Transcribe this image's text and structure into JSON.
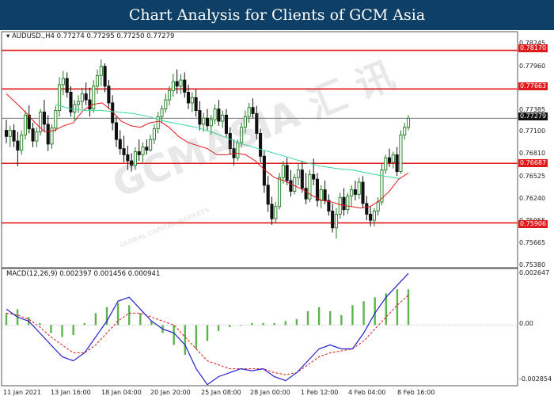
{
  "title": "Chart Analysis for Clients of GCM Asia",
  "watermark": {
    "main": "GCMASIA 汇 讯",
    "sub": "GLOBAL CAPITAL MARKETS"
  },
  "price_info": {
    "symbol": "AUDUSD.,H4",
    "open": "0.77274",
    "high": "0.77295",
    "low": "0.77250",
    "close": "0.77279"
  },
  "macd_info": {
    "name": "MACD(12,26,9)",
    "macd": "0.002397",
    "signal": "0.001456",
    "hist": "0.000941"
  },
  "price_ticks": [
    "0.78245",
    "0.77960",
    "0.77385",
    "0.77100",
    "0.76810",
    "0.76525",
    "0.76240",
    "0.75955",
    "0.75665",
    "0.75380"
  ],
  "macd_ticks": [
    "0.002647",
    "0.00",
    "-0.002854"
  ],
  "levels": [
    "0.78170",
    "0.77663",
    "0.76687",
    "0.75906"
  ],
  "current_price": "0.77279",
  "time_labels": [
    "11 Jan 2021",
    "13 Jan 16:00",
    "18 Jan 04:00",
    "20 Jan 20:00",
    "25 Jan 08:00",
    "28 Jan 00:00",
    "1 Feb 12:00",
    "4 Feb 04:00",
    "8 Feb 16:00"
  ],
  "colors": {
    "title_bg": "#0e3f66",
    "level": "#e0191b",
    "up": "#1f7a1f",
    "down": "#111111",
    "ma_fast": "#e0191b",
    "ma_slow": "#38d99a",
    "macd_line": "#2222cc",
    "signal_line": "#e0191b",
    "histogram": "#5bb54a"
  },
  "chart_data": {
    "type": "candlestick",
    "title": "",
    "symbol": "AUDUSD.,H4",
    "y_range": [
      0.7538,
      0.7829
    ],
    "support_resistance": [
      0.7817,
      0.77663,
      0.76687,
      0.75906
    ],
    "current_price": 0.77279,
    "ohlc": [
      [
        0.7712,
        0.7726,
        0.7695,
        0.7704
      ],
      [
        0.7704,
        0.7718,
        0.769,
        0.7712
      ],
      [
        0.7712,
        0.772,
        0.769,
        0.7698
      ],
      [
        0.7698,
        0.771,
        0.7665,
        0.7686
      ],
      [
        0.7686,
        0.7712,
        0.768,
        0.7706
      ],
      [
        0.7706,
        0.7738,
        0.77,
        0.7732
      ],
      [
        0.7732,
        0.7745,
        0.7708,
        0.7714
      ],
      [
        0.7714,
        0.7722,
        0.769,
        0.7698
      ],
      [
        0.7698,
        0.7716,
        0.769,
        0.771
      ],
      [
        0.771,
        0.774,
        0.7705,
        0.7736
      ],
      [
        0.7736,
        0.7752,
        0.771,
        0.772
      ],
      [
        0.772,
        0.7732,
        0.7685,
        0.7694
      ],
      [
        0.7694,
        0.772,
        0.7688,
        0.7715
      ],
      [
        0.7715,
        0.7744,
        0.771,
        0.7738
      ],
      [
        0.7738,
        0.7782,
        0.773,
        0.7772
      ],
      [
        0.7772,
        0.779,
        0.7758,
        0.778
      ],
      [
        0.778,
        0.7788,
        0.7755,
        0.7762
      ],
      [
        0.7762,
        0.777,
        0.773,
        0.7736
      ],
      [
        0.7736,
        0.7752,
        0.7725,
        0.7746
      ],
      [
        0.7746,
        0.7758,
        0.7735,
        0.775
      ],
      [
        0.775,
        0.7768,
        0.774,
        0.776
      ],
      [
        0.776,
        0.7775,
        0.7745,
        0.7752
      ],
      [
        0.7752,
        0.7768,
        0.773,
        0.774
      ],
      [
        0.774,
        0.7778,
        0.7735,
        0.777
      ],
      [
        0.777,
        0.7792,
        0.776,
        0.7784
      ],
      [
        0.7784,
        0.7805,
        0.777,
        0.7796
      ],
      [
        0.7796,
        0.78,
        0.7762,
        0.777
      ],
      [
        0.777,
        0.7778,
        0.774,
        0.7748
      ],
      [
        0.7748,
        0.7758,
        0.7712,
        0.7722
      ],
      [
        0.7722,
        0.773,
        0.769,
        0.77
      ],
      [
        0.77,
        0.7712,
        0.768,
        0.7688
      ],
      [
        0.7688,
        0.7705,
        0.767,
        0.768
      ],
      [
        0.768,
        0.7692,
        0.766,
        0.7672
      ],
      [
        0.7672,
        0.7682,
        0.7658,
        0.7666
      ],
      [
        0.7666,
        0.769,
        0.766,
        0.7684
      ],
      [
        0.7684,
        0.77,
        0.7672,
        0.768
      ],
      [
        0.768,
        0.7696,
        0.767,
        0.769
      ],
      [
        0.769,
        0.77,
        0.768,
        0.7686
      ],
      [
        0.7686,
        0.7706,
        0.7684,
        0.77
      ],
      [
        0.77,
        0.772,
        0.7694,
        0.7714
      ],
      [
        0.7714,
        0.7736,
        0.7708,
        0.773
      ],
      [
        0.773,
        0.7745,
        0.7722,
        0.774
      ],
      [
        0.774,
        0.776,
        0.7735,
        0.7752
      ],
      [
        0.7752,
        0.777,
        0.7745,
        0.7764
      ],
      [
        0.7764,
        0.7786,
        0.7756,
        0.7776
      ],
      [
        0.7776,
        0.7792,
        0.776,
        0.777
      ],
      [
        0.777,
        0.7786,
        0.776,
        0.7778
      ],
      [
        0.7778,
        0.7788,
        0.7755,
        0.7762
      ],
      [
        0.7762,
        0.7772,
        0.774,
        0.7748
      ],
      [
        0.7748,
        0.7762,
        0.7736,
        0.7755
      ],
      [
        0.7755,
        0.7766,
        0.773,
        0.7738
      ],
      [
        0.7738,
        0.775,
        0.7712,
        0.772
      ],
      [
        0.772,
        0.7735,
        0.771,
        0.7728
      ],
      [
        0.7728,
        0.774,
        0.7712,
        0.7718
      ],
      [
        0.7718,
        0.7732,
        0.7706,
        0.7726
      ],
      [
        0.7726,
        0.7746,
        0.772,
        0.774
      ],
      [
        0.774,
        0.7752,
        0.7718,
        0.7724
      ],
      [
        0.7724,
        0.7738,
        0.7715,
        0.7732
      ],
      [
        0.7732,
        0.774,
        0.7702,
        0.7708
      ],
      [
        0.7708,
        0.7716,
        0.768,
        0.7688
      ],
      [
        0.7688,
        0.77,
        0.7666,
        0.7676
      ],
      [
        0.7676,
        0.77,
        0.7672,
        0.7696
      ],
      [
        0.7696,
        0.7722,
        0.769,
        0.7716
      ],
      [
        0.7716,
        0.7738,
        0.7708,
        0.773
      ],
      [
        0.773,
        0.7748,
        0.7722,
        0.7742
      ],
      [
        0.7742,
        0.7754,
        0.7728,
        0.7734
      ],
      [
        0.7734,
        0.7744,
        0.77,
        0.7708
      ],
      [
        0.7708,
        0.7714,
        0.767,
        0.7678
      ],
      [
        0.7678,
        0.7685,
        0.763,
        0.764
      ],
      [
        0.764,
        0.7652,
        0.7605,
        0.7615
      ],
      [
        0.7615,
        0.7625,
        0.7588,
        0.7596
      ],
      [
        0.7596,
        0.7618,
        0.759,
        0.7612
      ],
      [
        0.7612,
        0.7656,
        0.7608,
        0.765
      ],
      [
        0.765,
        0.7672,
        0.7642,
        0.7666
      ],
      [
        0.7666,
        0.7676,
        0.764,
        0.7646
      ],
      [
        0.7646,
        0.766,
        0.7625,
        0.7632
      ],
      [
        0.7632,
        0.7655,
        0.7628,
        0.765
      ],
      [
        0.765,
        0.7668,
        0.764,
        0.766
      ],
      [
        0.766,
        0.7672,
        0.763,
        0.7636
      ],
      [
        0.7636,
        0.7656,
        0.7615,
        0.7622
      ],
      [
        0.7622,
        0.766,
        0.7618,
        0.7654
      ],
      [
        0.7654,
        0.7675,
        0.764,
        0.7648
      ],
      [
        0.7648,
        0.7656,
        0.7612,
        0.762
      ],
      [
        0.762,
        0.764,
        0.761,
        0.7634
      ],
      [
        0.7634,
        0.7646,
        0.7615,
        0.762
      ],
      [
        0.762,
        0.7628,
        0.76,
        0.7606
      ],
      [
        0.7606,
        0.7616,
        0.7578,
        0.7584
      ],
      [
        0.7584,
        0.761,
        0.757,
        0.7602
      ],
      [
        0.7602,
        0.763,
        0.7596,
        0.7624
      ],
      [
        0.7624,
        0.7636,
        0.76,
        0.7608
      ],
      [
        0.7608,
        0.763,
        0.7602,
        0.7626
      ],
      [
        0.7626,
        0.764,
        0.7612,
        0.7634
      ],
      [
        0.7634,
        0.7646,
        0.762,
        0.7628
      ],
      [
        0.7628,
        0.765,
        0.7622,
        0.7644
      ],
      [
        0.7644,
        0.7652,
        0.761,
        0.7616
      ],
      [
        0.7616,
        0.7626,
        0.7594,
        0.7602
      ],
      [
        0.7602,
        0.7612,
        0.7586,
        0.7594
      ],
      [
        0.7594,
        0.761,
        0.7586,
        0.7606
      ],
      [
        0.7606,
        0.7624,
        0.76,
        0.7618
      ],
      [
        0.7618,
        0.7668,
        0.7614,
        0.766
      ],
      [
        0.766,
        0.768,
        0.7655,
        0.7676
      ],
      [
        0.7676,
        0.7688,
        0.7664,
        0.767
      ],
      [
        0.767,
        0.7684,
        0.7662,
        0.768
      ],
      [
        0.768,
        0.769,
        0.7652,
        0.7658
      ],
      [
        0.7658,
        0.7712,
        0.7655,
        0.7706
      ],
      [
        0.7706,
        0.7722,
        0.77,
        0.7716
      ],
      [
        0.7716,
        0.7732,
        0.7712,
        0.7728
      ]
    ],
    "ma_fast": {
      "color": "#e0191b",
      "values": [
        0.776,
        0.7748,
        0.7736,
        0.7722,
        0.771,
        0.7712,
        0.7718,
        0.7722,
        0.7738,
        0.7746,
        0.7748,
        0.7738,
        0.7724,
        0.7718,
        0.7716,
        0.7722,
        0.7724,
        0.7716,
        0.7704,
        0.7696,
        0.7692,
        0.7688,
        0.768,
        0.768,
        0.7682,
        0.768,
        0.7672,
        0.766,
        0.765,
        0.7646,
        0.764,
        0.7634,
        0.7626,
        0.762,
        0.7618,
        0.7614,
        0.7612,
        0.761,
        0.7612,
        0.762,
        0.7632,
        0.7648,
        0.7656
      ]
    },
    "ma_slow": {
      "color": "#38d99a",
      "values": [
        0.7746,
        0.774,
        0.7738,
        0.7738,
        0.7736,
        0.7734,
        0.773,
        0.7724,
        0.772,
        0.7716,
        0.771,
        0.7702,
        0.7694,
        0.7688,
        0.7682,
        0.7676,
        0.767,
        0.7665,
        0.7662,
        0.766,
        0.7656,
        0.7652,
        0.7649
      ]
    },
    "macd": {
      "name": "MACD(12,26,9)",
      "y_range": [
        -0.002854,
        0.002647
      ],
      "histogram_sample": [
        0.0006,
        0.0008,
        0.0004,
        0.0001,
        -0.0004,
        -0.0006,
        -0.0005,
        0.0001,
        0.0006,
        0.0009,
        0.0011,
        0.001,
        0.0006,
        0.0002,
        -0.0004,
        -0.001,
        -0.0015,
        -0.0012,
        -0.0008,
        -0.0003,
        -0.0001,
        0.0,
        0.0001,
        0.0001,
        0.0001,
        0.0002,
        0.0003,
        0.0007,
        0.0009,
        0.0007,
        0.0005,
        0.001,
        0.0012,
        0.0014,
        0.0016,
        0.0018,
        0.0018
      ],
      "macd_line": [
        0.0008,
        0.0004,
        0.0002,
        -0.0004,
        -0.001,
        -0.0016,
        -0.0018,
        -0.0014,
        -0.0006,
        0.0002,
        0.0012,
        0.0014,
        0.0008,
        0.0002,
        -0.0002,
        -0.0004,
        -0.001,
        -0.0022,
        -0.003,
        -0.0026,
        -0.0024,
        -0.0022,
        -0.0023,
        -0.0022,
        -0.0026,
        -0.0028,
        -0.0024,
        -0.0018,
        -0.0012,
        -0.001,
        -0.0012,
        -0.0012,
        -0.0004,
        0.0006,
        0.0014,
        0.002,
        0.0026
      ],
      "signal_line": [
        0.0006,
        0.0005,
        0.0003,
        -0.0001,
        -0.0006,
        -0.001,
        -0.0014,
        -0.0014,
        -0.001,
        -0.0004,
        0.0002,
        0.0006,
        0.0006,
        0.0004,
        0.0002,
        0.0,
        -0.0006,
        -0.0012,
        -0.0018,
        -0.002,
        -0.0022,
        -0.0022,
        -0.0022,
        -0.0022,
        -0.0024,
        -0.0025,
        -0.0024,
        -0.002,
        -0.0016,
        -0.0014,
        -0.0013,
        -0.0012,
        -0.0008,
        -0.0002,
        0.0004,
        0.001,
        0.0015
      ]
    }
  }
}
